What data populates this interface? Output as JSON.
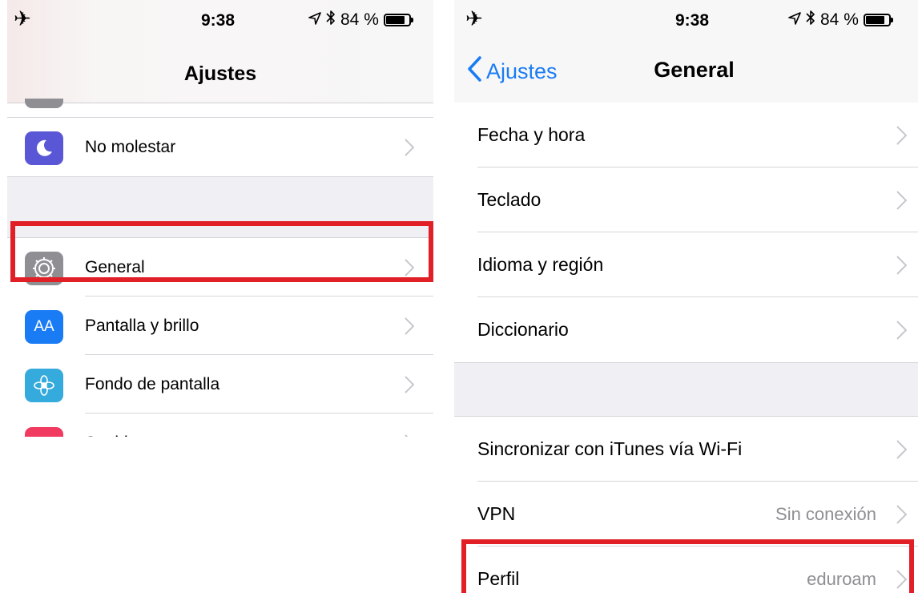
{
  "left": {
    "status": {
      "time": "9:38",
      "battery": "84 %",
      "battery_level": 0.84
    },
    "nav_title": "Ajustes",
    "items": [
      {
        "label": "No molestar",
        "icon": "moon-icon",
        "color": "#5a57d6"
      },
      {
        "label": "General",
        "icon": "gear-icon",
        "color": "#8e8e93"
      },
      {
        "label": "Pantalla y brillo",
        "icon": "text-size-icon",
        "icon_text": "AA",
        "color": "#1a7cf5"
      },
      {
        "label": "Fondo de pantalla",
        "icon": "flower-icon",
        "color": "#35aadc"
      },
      {
        "label": "Sonidos",
        "icon": "speaker-icon",
        "color": "#f03a5f"
      }
    ]
  },
  "right": {
    "status": {
      "time": "9:38",
      "battery": "84 %",
      "battery_level": 0.84
    },
    "back_label": "Ajustes",
    "nav_title": "General",
    "group1": [
      {
        "label": "Fecha y hora"
      },
      {
        "label": "Teclado"
      },
      {
        "label": "Idioma y región"
      },
      {
        "label": "Diccionario"
      }
    ],
    "group2": [
      {
        "label": "Sincronizar con iTunes vía Wi-Fi",
        "detail": ""
      },
      {
        "label": "VPN",
        "detail": "Sin conexión"
      },
      {
        "label": "Perfil",
        "detail": "eduroam"
      }
    ]
  },
  "colors": {
    "accent": "#1a7cf5",
    "highlight": "#e11f26"
  }
}
